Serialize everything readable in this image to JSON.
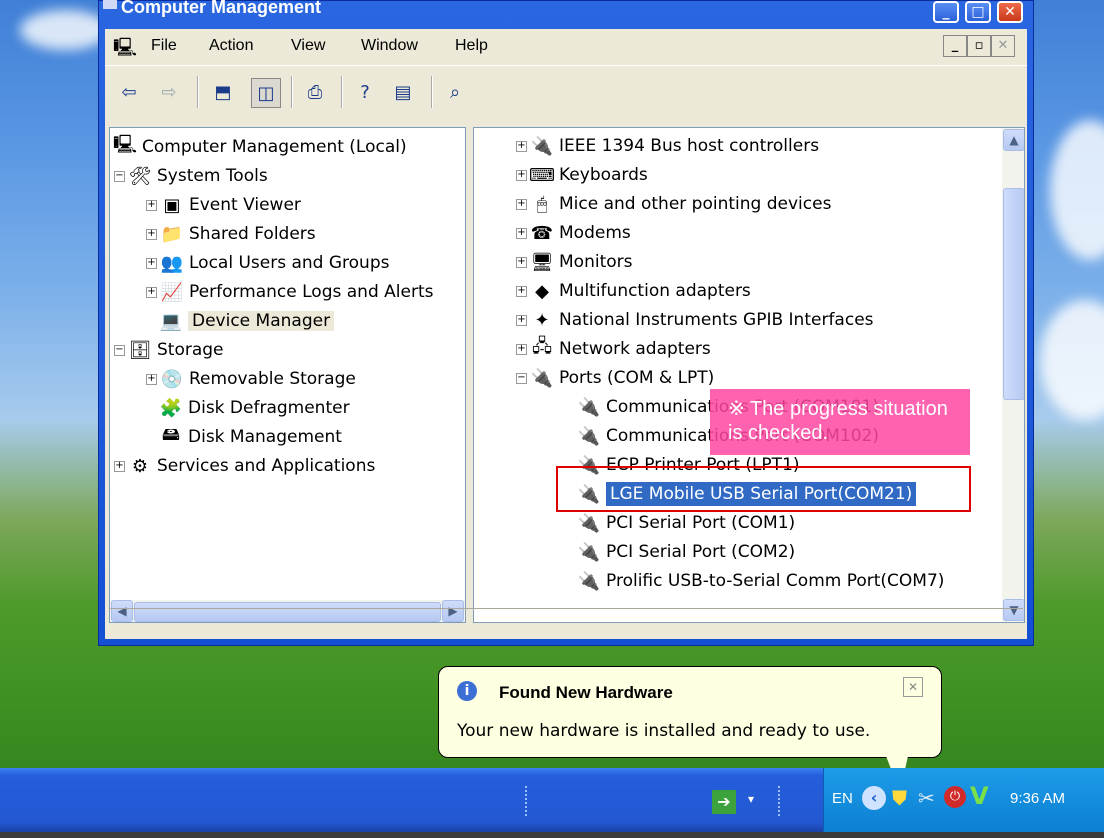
{
  "window": {
    "title": "Computer Management",
    "menu": [
      "File",
      "Action",
      "View",
      "Window",
      "Help"
    ]
  },
  "tree": {
    "root": "Computer Management (Local)",
    "items": [
      {
        "label": "System Tools",
        "level": 1
      },
      {
        "label": "Event Viewer",
        "level": 2
      },
      {
        "label": "Shared Folders",
        "level": 2
      },
      {
        "label": "Local Users and Groups",
        "level": 2
      },
      {
        "label": "Performance Logs and Alerts",
        "level": 2
      },
      {
        "label": "Device Manager",
        "level": 2,
        "selected": true
      },
      {
        "label": "Storage",
        "level": 1
      },
      {
        "label": "Removable Storage",
        "level": 2
      },
      {
        "label": "Disk Defragmenter",
        "level": 2
      },
      {
        "label": "Disk Management",
        "level": 2
      },
      {
        "label": "Services and Applications",
        "level": 1
      }
    ]
  },
  "devices": {
    "items": [
      "IEEE 1394 Bus host controllers",
      "Keyboards",
      "Mice and other pointing devices",
      "Modems",
      "Monitors",
      "Multifunction adapters",
      "National Instruments GPIB Interfaces",
      "Network adapters",
      "Ports (COM & LPT)"
    ],
    "ports": [
      "Communications Port (COM101)",
      "Communications Port (COM102)",
      "ECP Printer Port (LPT1)",
      "LGE Mobile USB Serial Port(COM21)",
      "PCI Serial Port (COM1)",
      "PCI Serial Port (COM2)",
      "Prolific USB-to-Serial Comm Port(COM7)"
    ],
    "selected_port": "LGE Mobile USB Serial Port(COM21)"
  },
  "annotation": {
    "note_line1": "※ The progress situation",
    "note_line2": "is checked."
  },
  "balloon": {
    "title": "Found New Hardware",
    "message": "Your new hardware is installed and ready to use."
  },
  "taskbar": {
    "lang": "EN",
    "clock": "9:36 AM"
  },
  "colors": {
    "selection": "#316ac5",
    "highlight_box": "#e00000",
    "note_bg": "#ff46a0"
  }
}
